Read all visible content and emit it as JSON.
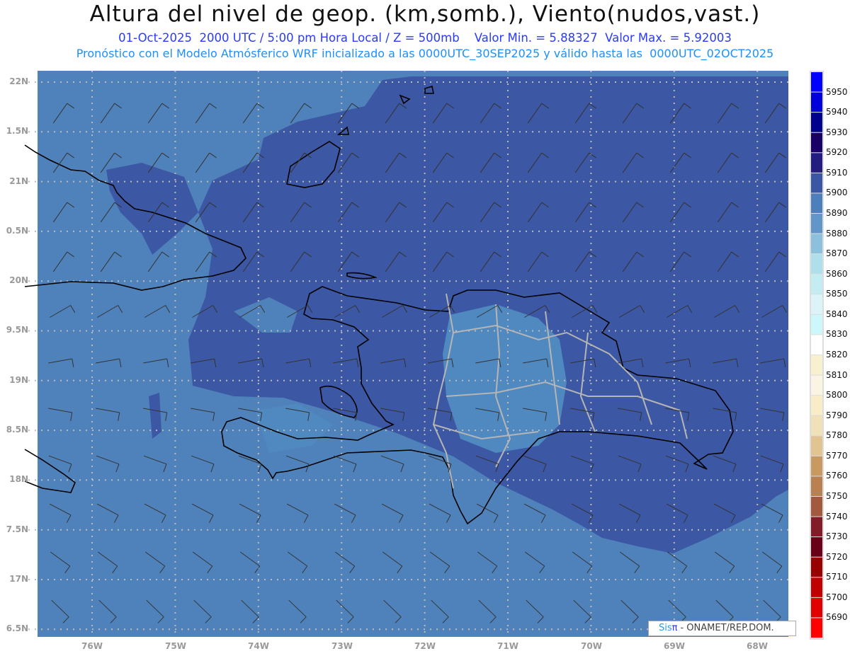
{
  "header": {
    "title": "Altura del nivel de geop. (km,somb.), Viento(nudos,vast.)",
    "subtitle": "01-Oct-2025  2000 UTC / 5:00 pm Hora Local / Z = 500mb    Valor Min. = 5.88327  Valor Max. = 5.92003",
    "forecast_info": "Pronóstico con el Modelo Atmósferico WRF inicializado a las 0000UTC_30SEP2025 y válido hasta las  0000UTC_02OCT2025"
  },
  "axes": {
    "lat_labels": [
      "22N",
      "1.5N",
      "21N",
      "0.5N",
      "20N",
      "9.5N",
      "19N",
      "8.5N",
      "18N",
      "7.5N",
      "17N",
      "6.5N"
    ],
    "lon_labels": [
      "76W",
      "75W",
      "74W",
      "73W",
      "72W",
      "71W",
      "70W",
      "69W",
      "68W"
    ]
  },
  "colorbar": {
    "labels": [
      "5950",
      "5940",
      "5930",
      "5920",
      "5910",
      "5900",
      "5890",
      "5880",
      "5870",
      "5860",
      "5850",
      "5840",
      "5830",
      "5820",
      "5810",
      "5800",
      "5790",
      "5780",
      "5770",
      "5760",
      "5750",
      "5740",
      "5730",
      "5720",
      "5710",
      "5700",
      "5690"
    ],
    "colors": [
      "#0000ff",
      "#0000dd",
      "#00008e",
      "#180066",
      "#241c80",
      "#3b56a2",
      "#4d80ba",
      "#6296c8",
      "#8dc0dd",
      "#b0dfec",
      "#c4ecf3",
      "#dcf4f8",
      "#ccf8fb",
      "#ffffff",
      "#f8f1d0",
      "#faf4e2",
      "#f8edc6",
      "#f0e1b8",
      "#e0c592",
      "#c89a62",
      "#b98151",
      "#a15a3e",
      "#821c28",
      "#690018",
      "#990000",
      "#c00000",
      "#e00000",
      "#ff0000"
    ]
  },
  "field_colors": {
    "ocean_light": "#4f82bb",
    "dark": "#3c57a3",
    "land_patch": "#5a8cc4"
  },
  "logo": {
    "sis": "Sis",
    "pi": "π",
    "text": "- ONAMET/REP.DOM."
  }
}
